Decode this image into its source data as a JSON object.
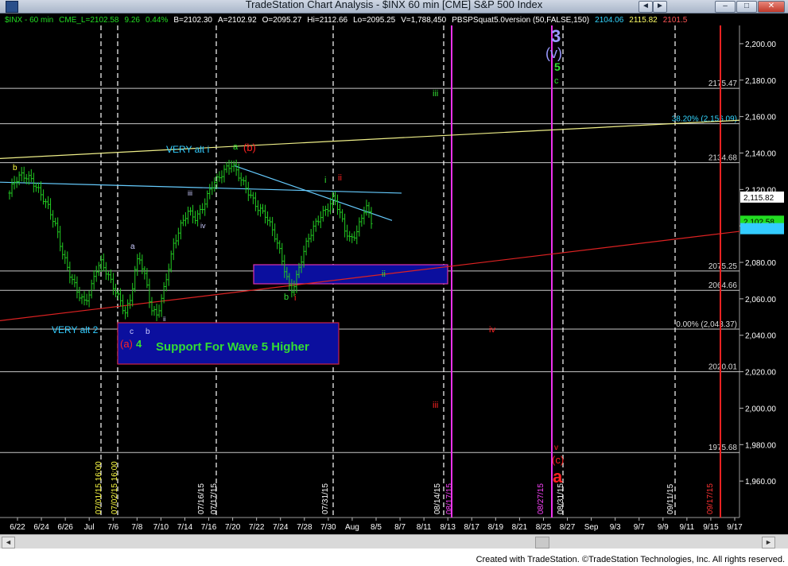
{
  "window": {
    "title": "TradeStation Chart Analysis - $INX 60 min [CME] S&P 500 Index",
    "buttons": {
      "back": "◄",
      "forward": "►",
      "minimize": "–",
      "maximize": "□",
      "close": "✕"
    }
  },
  "status_bar": {
    "segments": [
      {
        "text": "$INX - 60 min",
        "color": "#22dd22"
      },
      {
        "text": "CME_L=2102.58",
        "color": "#22dd22"
      },
      {
        "text": "9.26",
        "color": "#22dd22"
      },
      {
        "text": "0.44%",
        "color": "#22dd22"
      },
      {
        "text": "B=2102.30",
        "color": "#ffffff"
      },
      {
        "text": "A=2102.92",
        "color": "#ffffff"
      },
      {
        "text": "O=2095.27",
        "color": "#ffffff"
      },
      {
        "text": "Hi=2112.66",
        "color": "#ffffff"
      },
      {
        "text": "Lo=2095.25",
        "color": "#ffffff"
      },
      {
        "text": "V=1,788,450",
        "color": "#ffffff"
      },
      {
        "text": "PBSPSquat5.0version (50,FALSE,150)",
        "color": "#ffffff"
      },
      {
        "text": "2104.06",
        "color": "#33d6ff"
      },
      {
        "text": "2115.82",
        "color": "#ffff66"
      },
      {
        "text": "2101.5",
        "color": "#ff5555"
      }
    ]
  },
  "footer": {
    "text": "Created with TradeStation. ©TradeStation Technologies, Inc. All rights reserved."
  },
  "scrollbar": {
    "left_arrow": "◄",
    "right_arrow": "►"
  },
  "chart_data": {
    "type": "candlestick",
    "symbol": "$INX",
    "interval": "60 min",
    "ylim": [
      1940,
      2210
    ],
    "y_ticks": [
      1960,
      1980,
      2000,
      2020,
      2040,
      2060,
      2080,
      2100,
      2120,
      2140,
      2160,
      2180,
      2200
    ],
    "y_tick_labels": [
      "1,960.00",
      "1,980.00",
      "2,000.00",
      "2,020.00",
      "2,040.00",
      "2,060.00",
      "2,080.00",
      "2,100.00",
      "2,120.00",
      "2,140.00",
      "2,160.00",
      "2,180.00",
      "2,200.00"
    ],
    "x_ticks": [
      "6/22",
      "6/24",
      "6/26",
      "Jul",
      "7/6",
      "7/8",
      "7/10",
      "7/14",
      "7/16",
      "7/20",
      "7/22",
      "7/24",
      "7/28",
      "7/30",
      "Aug",
      "8/5",
      "8/7",
      "8/11",
      "8/13",
      "8/17",
      "8/19",
      "8/21",
      "8/25",
      "8/27",
      "Sep",
      "9/3",
      "9/7",
      "9/9",
      "9/11",
      "9/15",
      "9/17"
    ],
    "price_path": [
      [
        0,
        2118
      ],
      [
        0.3,
        2124
      ],
      [
        0.8,
        2128
      ],
      [
        1.5,
        2126
      ],
      [
        2.2,
        2118
      ],
      [
        2.8,
        2110
      ],
      [
        3.4,
        2098
      ],
      [
        3.8,
        2085
      ],
      [
        4.4,
        2072
      ],
      [
        5.0,
        2062
      ],
      [
        5.4,
        2058
      ],
      [
        5.8,
        2064
      ],
      [
        6.2,
        2076
      ],
      [
        6.6,
        2080
      ],
      [
        7.0,
        2074
      ],
      [
        7.5,
        2066
      ],
      [
        8.0,
        2058
      ],
      [
        8.3,
        2052
      ],
      [
        8.7,
        2060
      ],
      [
        9.0,
        2075
      ],
      [
        9.3,
        2084
      ],
      [
        9.8,
        2070
      ],
      [
        10.2,
        2054
      ],
      [
        10.6,
        2051
      ],
      [
        11.0,
        2062
      ],
      [
        11.4,
        2076
      ],
      [
        11.8,
        2090
      ],
      [
        12.3,
        2100
      ],
      [
        12.8,
        2108
      ],
      [
        13.4,
        2104
      ],
      [
        14.0,
        2112
      ],
      [
        14.5,
        2122
      ],
      [
        15.0,
        2126
      ],
      [
        15.5,
        2131
      ],
      [
        16.0,
        2134
      ],
      [
        16.6,
        2126
      ],
      [
        17.2,
        2118
      ],
      [
        17.8,
        2110
      ],
      [
        18.4,
        2106
      ],
      [
        19.0,
        2096
      ],
      [
        19.5,
        2084
      ],
      [
        19.9,
        2072
      ],
      [
        20.2,
        2064
      ],
      [
        20.5,
        2068
      ],
      [
        20.9,
        2080
      ],
      [
        21.4,
        2092
      ],
      [
        21.9,
        2100
      ],
      [
        22.4,
        2106
      ],
      [
        22.9,
        2110
      ],
      [
        23.3,
        2116
      ],
      [
        23.7,
        2108
      ],
      [
        24.1,
        2098
      ],
      [
        24.5,
        2092
      ],
      [
        24.9,
        2096
      ],
      [
        25.3,
        2104
      ],
      [
        25.6,
        2112
      ],
      [
        26.0,
        2102
      ]
    ],
    "horizontal_levels": [
      {
        "value": 2175.47,
        "label": "2175.47"
      },
      {
        "value": 2156.09,
        "label": "38.20% (2,156.09)",
        "color": "#33d6ff"
      },
      {
        "value": 2134.68,
        "label": "2134.68"
      },
      {
        "value": 2075.25,
        "label": "2075.25"
      },
      {
        "value": 2064.66,
        "label": "2064.66"
      },
      {
        "value": 2043.37,
        "label": "0.00% (2,043.37)"
      },
      {
        "value": 2020.01,
        "label": "2020.01"
      },
      {
        "value": 1975.68,
        "label": "1975.68"
      }
    ],
    "price_badges": [
      {
        "value": 2115.82,
        "label": "2,115.82",
        "bg": "#ffffff",
        "fg": "#000000"
      },
      {
        "value": 2102.58,
        "label": "2,102.58",
        "bg": "#22dd22",
        "fg": "#000000"
      },
      {
        "value": 2098.5,
        "label": "",
        "bg": "#33ccff",
        "fg": "#000000"
      }
    ],
    "vertical_date_labels": [
      {
        "label": "07/01/15 16:00",
        "color": "#ffff44"
      },
      {
        "label": "07/02/15 16:00",
        "color": "#ffff44"
      },
      {
        "label": "07/16/15",
        "color": "#ffffff"
      },
      {
        "label": "07/17/15",
        "color": "#ffffff"
      },
      {
        "label": "07/31/15",
        "color": "#ffffff"
      },
      {
        "label": "08/14/15",
        "color": "#ffffff"
      },
      {
        "label": "08/17/15",
        "color": "#ff44ff"
      },
      {
        "label": "08/27/15",
        "color": "#ff44ff"
      },
      {
        "label": "08/31/15",
        "color": "#ffffff"
      },
      {
        "label": "09/11/15",
        "color": "#ffffff"
      },
      {
        "label": "09/17/15",
        "color": "#ff3333"
      }
    ],
    "annotations": {
      "very_alt_i": "VERY alt i",
      "very_alt_2": "VERY alt 2",
      "support_box": "Support For Wave 5 Higher",
      "b_paren": "(b)",
      "a_paren": "(a)",
      "c_paren": "(c)",
      "v_paren": "(v)",
      "big_3": "3",
      "big_5": "5",
      "big_a": "a",
      "i_green": "i",
      "ii_red": "ii",
      "ii_green": "ii",
      "iii_green": "iii",
      "iii_red": "iii",
      "iv_red": "iv",
      "iii_small": "iii",
      "iv_small": "iv",
      "a_small": "a",
      "b_small": "b",
      "c_small": "c",
      "b_green": "b",
      "i_red": "i",
      "four_green": "4",
      "c_green": "c",
      "v_red": "v",
      "a_green": "a",
      "ii_small": "ii",
      "b_yellow": "b"
    }
  }
}
